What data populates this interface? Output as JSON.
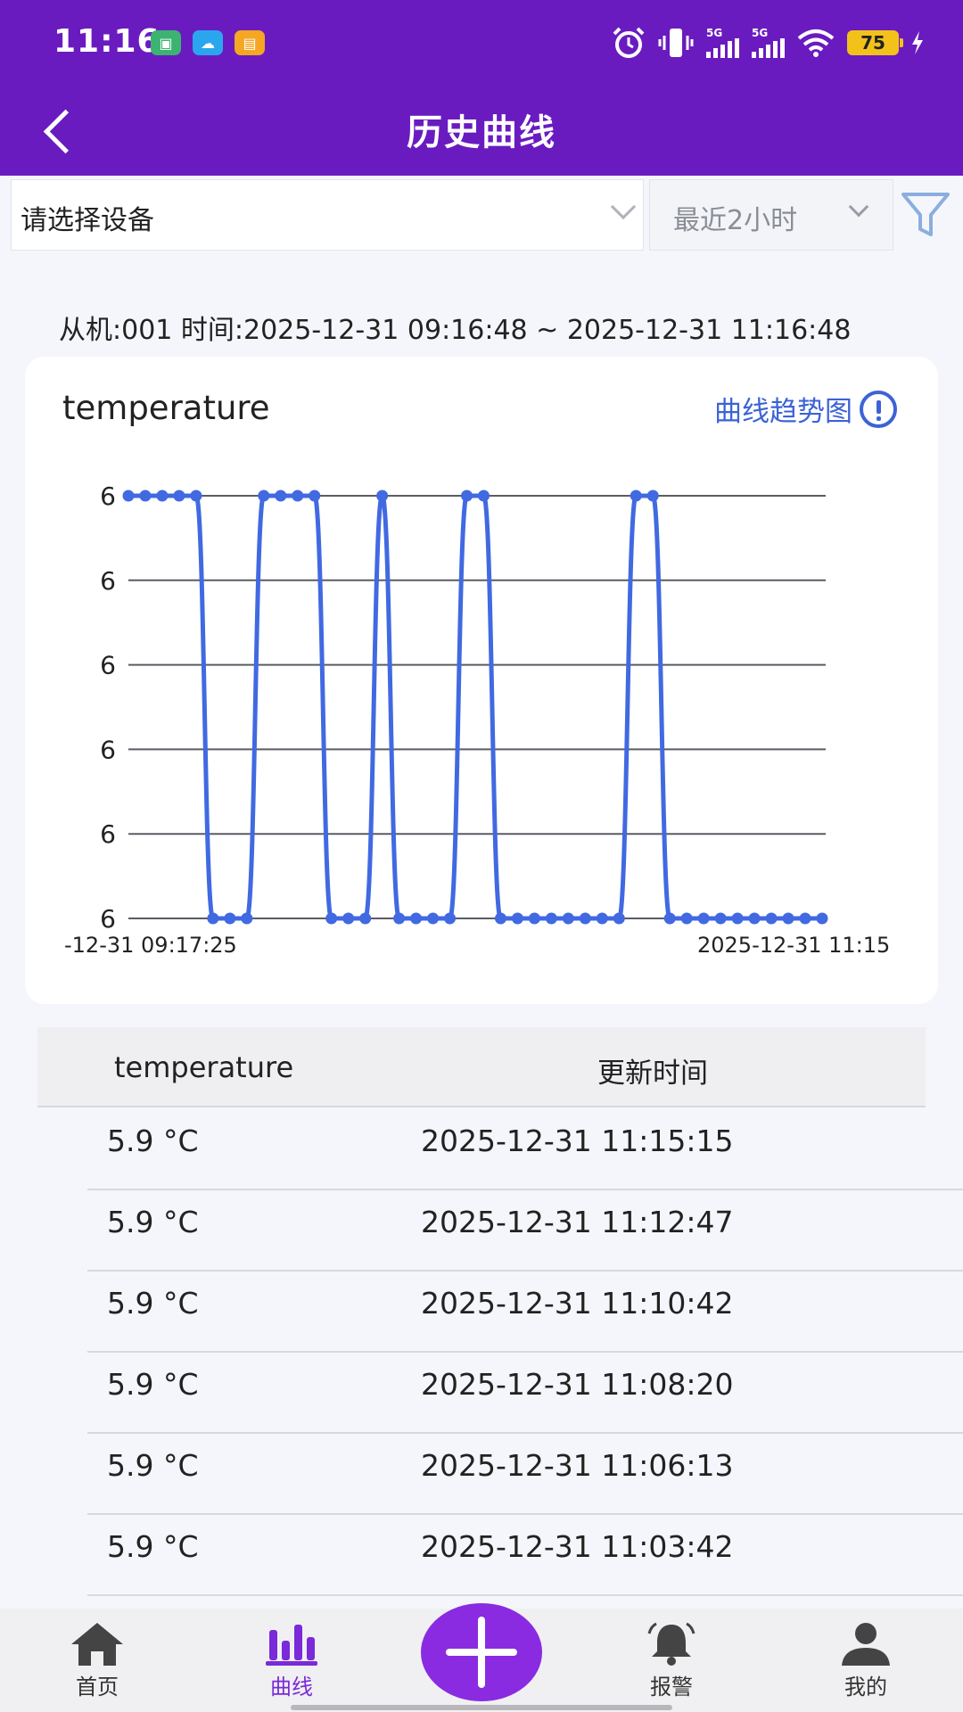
{
  "status_bar": {
    "time": "11:16",
    "network_1": "5G",
    "network_2": "5G",
    "battery": "75",
    "colors": {
      "background": "#6a1bc0",
      "battery": "#f2c21b"
    }
  },
  "header": {
    "title": "历史曲线"
  },
  "filters": {
    "device_placeholder": "请选择设备",
    "time_range": "最近2小时"
  },
  "info_line": "从机:001   时间:2025-12-31 09:16:48 ~ 2025-12-31 11:16:48",
  "chart_card": {
    "title": "temperature",
    "trend_link": "曲线趋势图"
  },
  "chart_data": {
    "type": "line",
    "title": "temperature",
    "y_tick_labels": [
      "6",
      "6",
      "6",
      "6",
      "6",
      "6"
    ],
    "x_tick_labels": [
      "-12-31 09:17:25",
      "2025-12-31 11:15"
    ],
    "ylim": [
      5.85,
      6.1
    ],
    "grid": true,
    "series": [
      {
        "color": "#4169e1",
        "values": [
          6.1,
          6.1,
          6.1,
          6.1,
          6.1,
          5.85,
          5.85,
          5.85,
          6.1,
          6.1,
          6.1,
          6.1,
          5.85,
          5.85,
          5.85,
          6.1,
          5.85,
          5.85,
          5.85,
          5.85,
          6.1,
          6.1,
          5.85,
          5.85,
          5.85,
          5.85,
          5.85,
          5.85,
          5.85,
          5.85,
          6.1,
          6.1,
          5.85,
          5.85,
          5.85,
          5.85,
          5.85,
          5.85,
          5.85,
          5.85,
          5.85,
          5.85
        ]
      }
    ]
  },
  "table": {
    "headers": [
      "temperature",
      "更新时间"
    ],
    "rows": [
      {
        "value": "5.9 °C",
        "time": "2025-12-31 11:15:15"
      },
      {
        "value": "5.9 °C",
        "time": "2025-12-31 11:12:47"
      },
      {
        "value": "5.9 °C",
        "time": "2025-12-31 11:10:42"
      },
      {
        "value": "5.9 °C",
        "time": "2025-12-31 11:08:20"
      },
      {
        "value": "5.9 °C",
        "time": "2025-12-31 11:06:13"
      },
      {
        "value": "5.9 °C",
        "time": "2025-12-31 11:03:42"
      }
    ]
  },
  "tabbar": {
    "items": [
      {
        "label": "首页",
        "icon": "home-icon"
      },
      {
        "label": "曲线",
        "icon": "bar-chart-icon",
        "active": true
      },
      {
        "label": "",
        "icon": "plus-icon"
      },
      {
        "label": "报警",
        "icon": "bell-icon"
      },
      {
        "label": "我的",
        "icon": "user-icon"
      }
    ],
    "active_color": "#7a2ad8",
    "plus_color": "#8a2be2"
  }
}
